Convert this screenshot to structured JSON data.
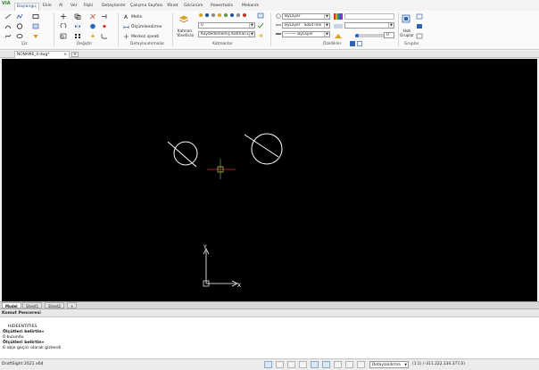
{
  "app": {
    "logo": "VIA",
    "version": "DraftSight 2021 x64"
  },
  "ribbon_tabs": [
    "Başlangıç",
    "Ekle",
    "Al",
    "Ver",
    "İlişki",
    "Detaylandır",
    "Çalışma Sayfası",
    "Yönet",
    "Görünüm",
    "Powertools",
    "Mekanik"
  ],
  "active_tab": "Başlangıç",
  "panels": {
    "ciz": "Çiz",
    "degistir": "Değiştir",
    "detaylandirmalar": "Detaylandırmalar",
    "katmanlar": "Katmanlar",
    "ozellikler": "Özellikler",
    "gruplar": "Gruplar"
  },
  "annot": {
    "metin": "Metin",
    "olcumlendirme": "Ölçümlendirme",
    "merkez_isareti": "Merkez işareti"
  },
  "layers": {
    "manager_label": "Katman Yöneticisi",
    "current_layer": "0",
    "state_combo": "Kaydedilmemiş Katman Du"
  },
  "properties": {
    "color": "ByLayer",
    "linestyle": "ByLayer",
    "linestyle_name": "Solid line",
    "lineweight": "——— ByLayer",
    "transparency_value": "0"
  },
  "groups": {
    "quick_group": "Hızlı Gruplar"
  },
  "document": {
    "tab_name": "NONAME_0.dwg*",
    "close": "×",
    "add": "+"
  },
  "layout_tabs": [
    "Model",
    "Sheet1",
    "Sheet2",
    "+"
  ],
  "command": {
    "title": "Komut Penceresi",
    "lines": [
      "HIDEENTITIES",
      "Ölçütleri belirtin»",
      "0 bulundu",
      "Ölçütleri belirtin»",
      "6 obje geçici olarak gizlendi"
    ]
  },
  "status": {
    "workspace": "Detaylandırma",
    "scale": "(1:1)",
    "coordinates": "(-311.222,134.377,0)"
  },
  "colors": {
    "canvas": "#000000",
    "accent": "#1a4f9a"
  }
}
